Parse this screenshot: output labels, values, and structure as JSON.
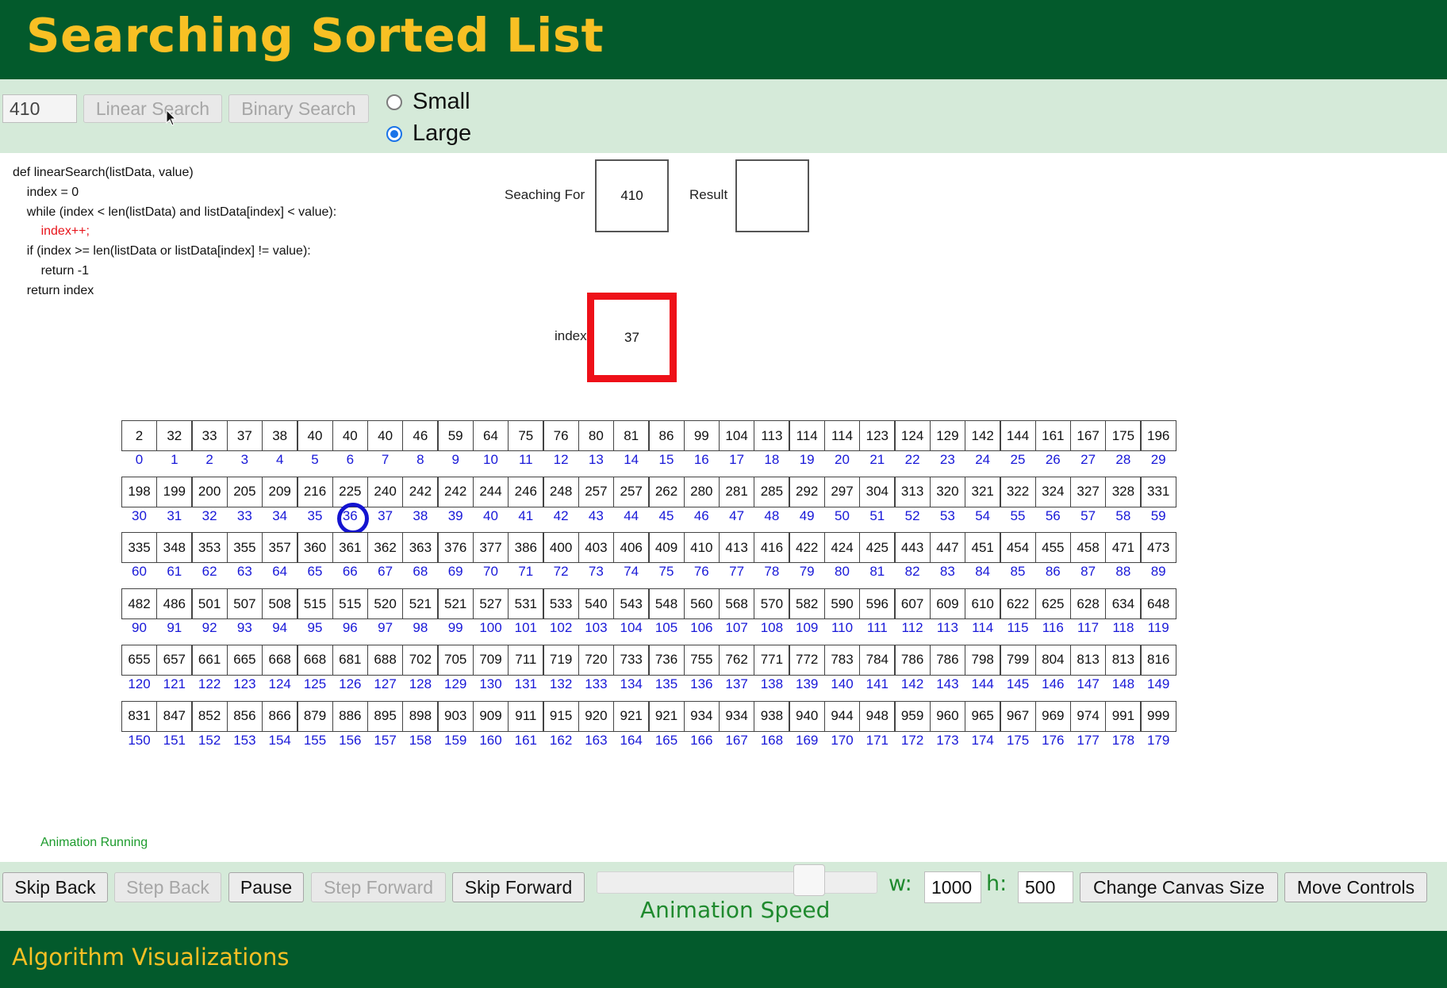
{
  "header": {
    "title": "Searching Sorted List"
  },
  "controls": {
    "search_value": "410",
    "linear_label": "Linear Search",
    "binary_label": "Binary Search",
    "size_small": "Small",
    "size_large": "Large",
    "selected_size": "Large"
  },
  "code": {
    "lines": [
      "def linearSearch(listData, value)",
      "    index = 0",
      "    while (index < len(listData) and listData[index] < value):",
      "        index++;",
      "    if (index >= len(listData or listData[index] != value):",
      "        return -1",
      "    return index"
    ],
    "highlight_line": 3
  },
  "state": {
    "searching_for_label": "Seaching For",
    "searching_for_value": "410",
    "result_label": "Result",
    "result_value": "",
    "index_label": "index",
    "index_value": "37",
    "current_index": 36
  },
  "array": {
    "values": [
      2,
      32,
      33,
      37,
      38,
      40,
      40,
      40,
      46,
      59,
      64,
      75,
      76,
      80,
      81,
      86,
      99,
      104,
      113,
      114,
      114,
      123,
      124,
      129,
      142,
      144,
      161,
      167,
      175,
      196,
      198,
      199,
      200,
      205,
      209,
      216,
      225,
      240,
      242,
      242,
      244,
      246,
      248,
      257,
      257,
      262,
      280,
      281,
      285,
      292,
      297,
      304,
      313,
      320,
      321,
      322,
      324,
      327,
      328,
      331,
      335,
      348,
      353,
      355,
      357,
      360,
      361,
      362,
      363,
      376,
      377,
      386,
      400,
      403,
      406,
      409,
      410,
      413,
      416,
      422,
      424,
      425,
      443,
      447,
      451,
      454,
      455,
      458,
      471,
      473,
      482,
      486,
      501,
      507,
      508,
      515,
      515,
      520,
      521,
      521,
      527,
      531,
      533,
      540,
      543,
      548,
      560,
      568,
      570,
      582,
      590,
      596,
      607,
      609,
      610,
      622,
      625,
      628,
      634,
      648,
      655,
      657,
      661,
      665,
      668,
      668,
      681,
      688,
      702,
      705,
      709,
      711,
      719,
      720,
      733,
      736,
      755,
      762,
      771,
      772,
      783,
      784,
      786,
      786,
      798,
      799,
      804,
      813,
      813,
      816,
      831,
      847,
      852,
      856,
      866,
      879,
      886,
      895,
      898,
      903,
      909,
      911,
      915,
      920,
      921,
      921,
      934,
      934,
      938,
      940,
      944,
      948,
      959,
      960,
      965,
      967,
      969,
      974,
      991,
      999
    ],
    "columns": 30
  },
  "status": {
    "text": "Animation Running"
  },
  "bottom": {
    "skip_back": "Skip Back",
    "step_back": "Step Back",
    "pause": "Pause",
    "step_forward": "Step Forward",
    "skip_forward": "Skip Forward",
    "speed_label": "Animation Speed",
    "w_label": "w:",
    "w_value": "1000",
    "h_label": "h:",
    "h_value": "500",
    "change_canvas": "Change Canvas Size",
    "move_controls": "Move Controls"
  },
  "footer": {
    "text": "Algorithm Visualizations"
  },
  "colors": {
    "header_bg": "#035a2c",
    "title": "#f8c024",
    "panel_bg": "#d5ead9",
    "index_text": "#1818d8",
    "highlight_red": "#ee1018",
    "status_green": "#1d9b2d"
  }
}
